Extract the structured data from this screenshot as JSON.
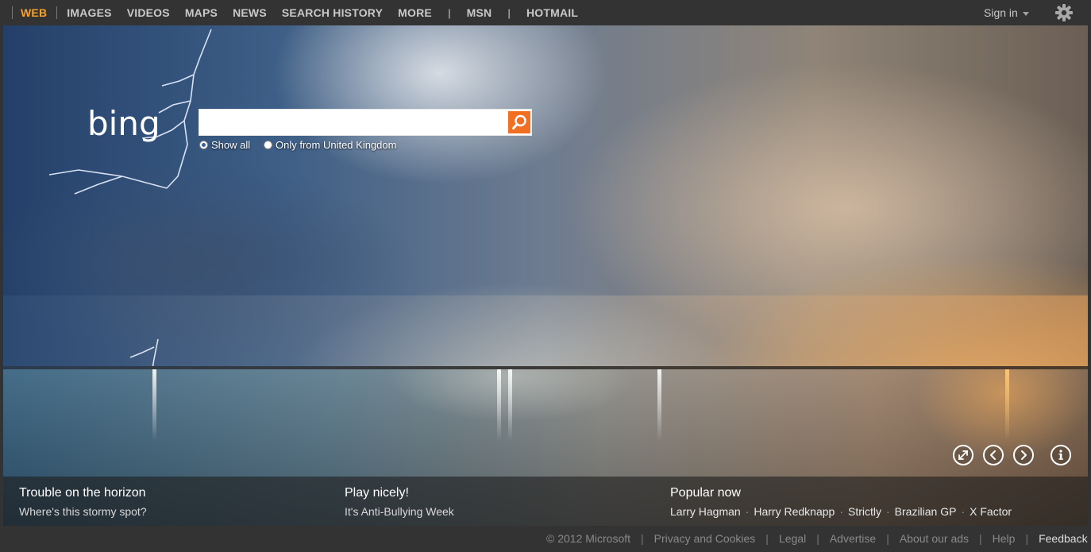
{
  "nav": {
    "items": [
      "WEB",
      "IMAGES",
      "VIDEOS",
      "MAPS",
      "NEWS",
      "SEARCH HISTORY",
      "MORE",
      "MSN",
      "HOTMAIL"
    ],
    "divider": "|",
    "active": "WEB"
  },
  "account": {
    "sign_in": "Sign in"
  },
  "search": {
    "logo": "bing",
    "query": "",
    "options": {
      "show_all": "Show all",
      "uk_only": "Only from United Kingdom"
    }
  },
  "hotspots": [
    {
      "title": "Trouble on the horizon",
      "subtitle": "Where's this stormy spot?"
    },
    {
      "title": "Play nicely!",
      "subtitle": "It's Anti-Bullying Week"
    }
  ],
  "popular": {
    "title": "Popular now",
    "separator": "·",
    "items": [
      "Larry Hagman",
      "Harry Redknapp",
      "Strictly",
      "Brazilian GP",
      "X Factor"
    ]
  },
  "footer": {
    "copyright": "© 2012 Microsoft",
    "separator": "|",
    "links": [
      "Privacy and Cookies",
      "Legal",
      "Advertise",
      "About our ads",
      "Help"
    ],
    "feedback": "Feedback"
  },
  "colors": {
    "bar_bg": "#333333",
    "active_nav": "#f7a12c",
    "search_button": "#f26f21"
  },
  "icons": [
    "gear-icon",
    "search-icon",
    "expand-icon",
    "prev-icon",
    "next-icon",
    "info-icon"
  ]
}
